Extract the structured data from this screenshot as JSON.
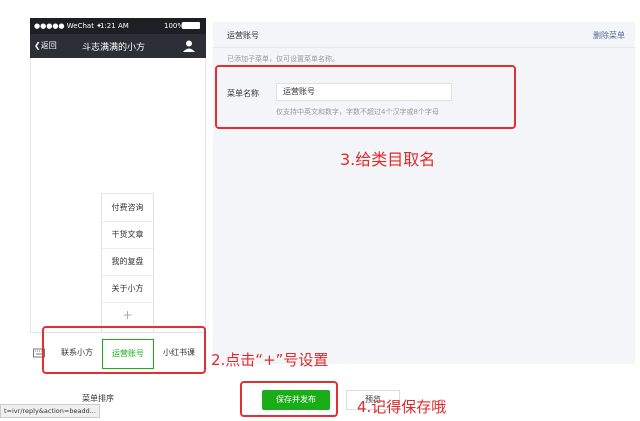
{
  "phone": {
    "status_carrier": "●●●●● WeChat ✦",
    "status_time": "1:21 AM",
    "status_battery": "100%",
    "back_label": "❮返回",
    "title": "斗志满满的小方",
    "submenu": [
      "付费咨询",
      "干货文章",
      "我的复盘",
      "关于小方",
      "+"
    ],
    "menu_tabs": [
      "联系小方",
      "运营账号",
      "小红书课"
    ]
  },
  "panel": {
    "title": "运营账号",
    "delete_label": "删除菜单",
    "hint": "已添加子菜单，仅可设置菜单名称。",
    "field_label": "菜单名称",
    "field_value": "运营账号",
    "field_help": "仅支持中英文和数字，字数不超过4个汉字或8个字母"
  },
  "annotations": {
    "a1": "3.给类目取名",
    "a2": "2.点击“+”号设置",
    "a3": "4.记得保存哦"
  },
  "footer": {
    "sort_label": "菜单排序",
    "save_label": "保存并发布",
    "preview_label": "预览",
    "status_url": "t=ivr/reply&action=beadd..."
  },
  "colors": {
    "accent_green": "#1aad19",
    "annotation_red": "#e23030"
  }
}
